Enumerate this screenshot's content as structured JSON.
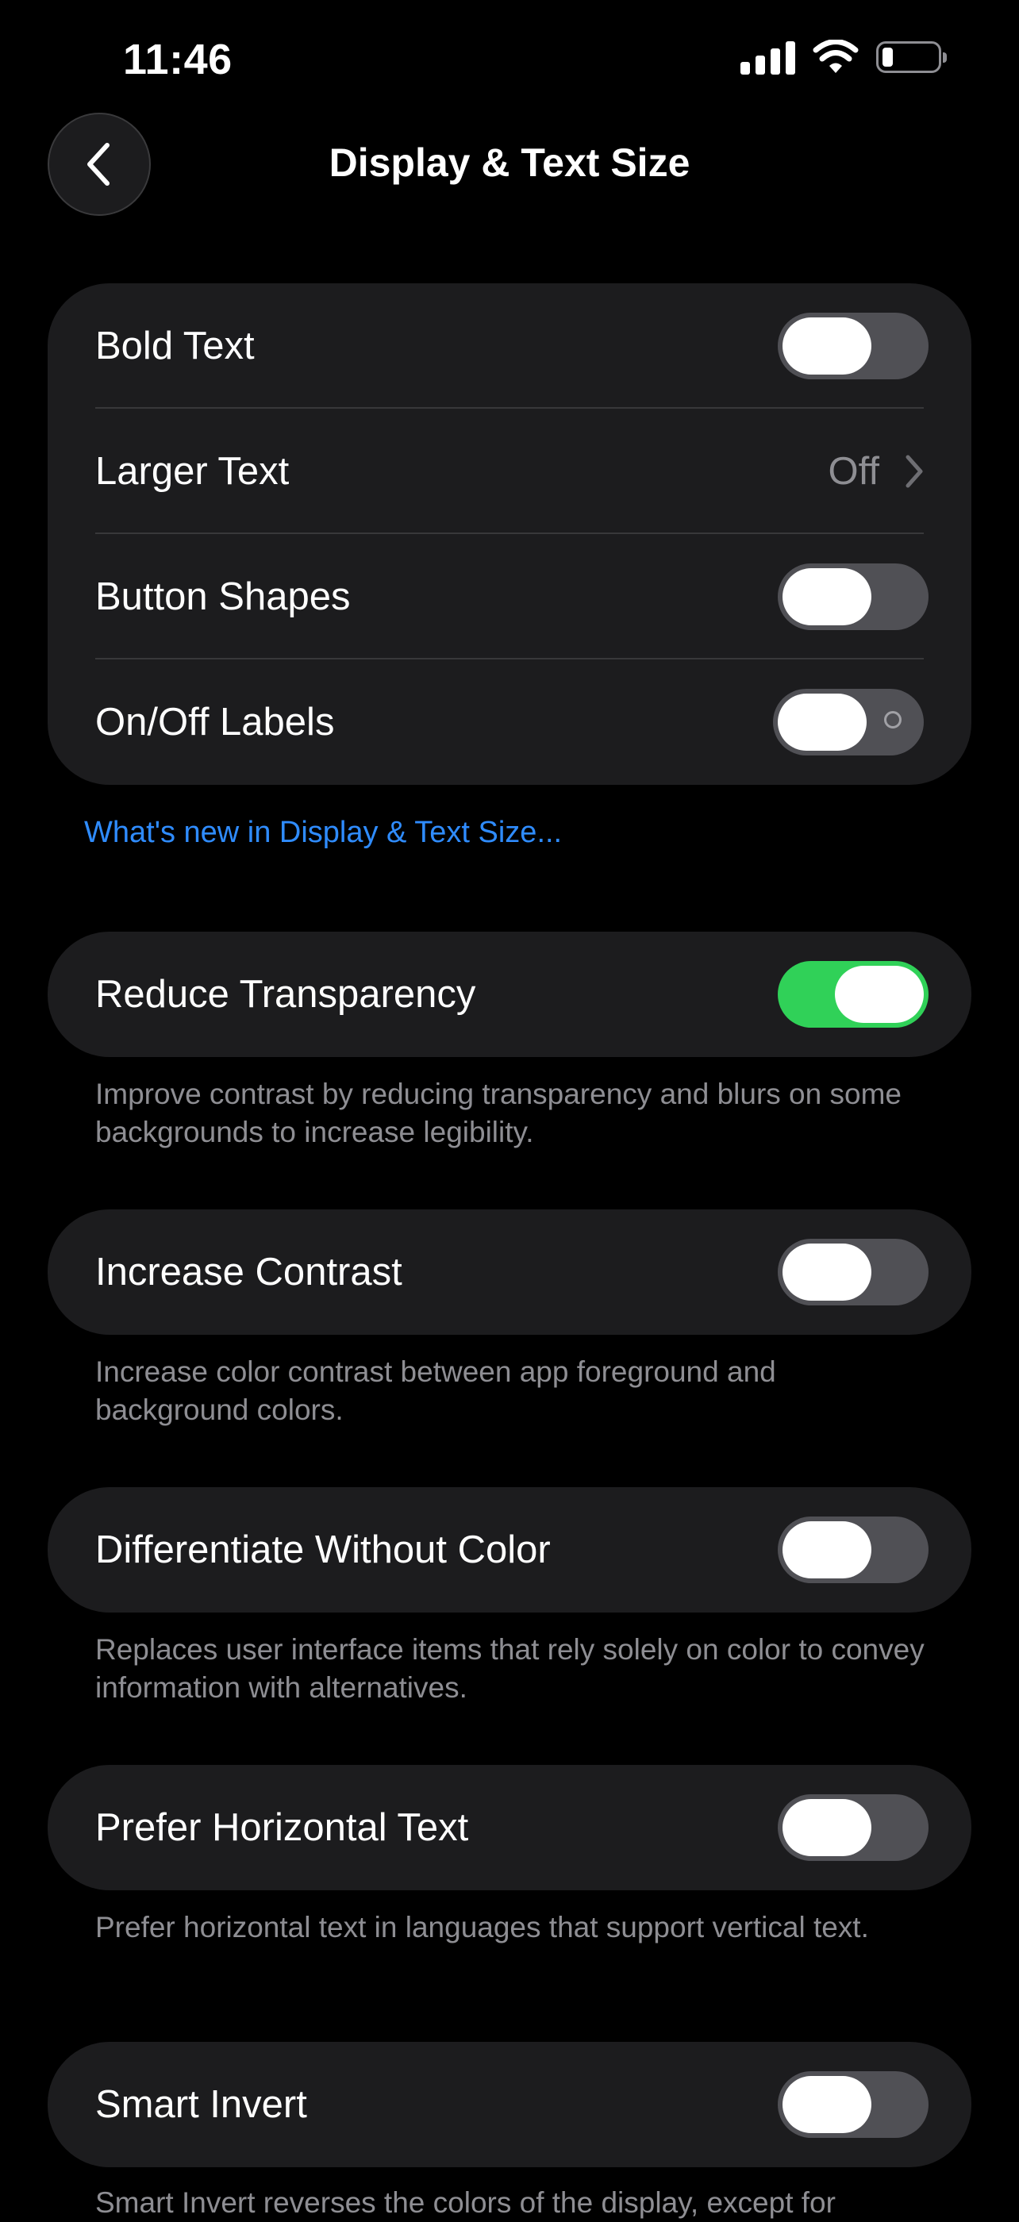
{
  "status": {
    "time": "11:46"
  },
  "header": {
    "title": "Display & Text Size"
  },
  "group1": {
    "rows": [
      {
        "label": "Bold Text"
      },
      {
        "label": "Larger Text",
        "value": "Off"
      },
      {
        "label": "Button Shapes"
      },
      {
        "label": "On/Off Labels"
      }
    ]
  },
  "link": "What's new in Display & Text Size...",
  "reduce_transparency": {
    "label": "Reduce Transparency",
    "footnote": "Improve contrast by reducing transparency and blurs on some backgrounds to increase legibility."
  },
  "increase_contrast": {
    "label": "Increase Contrast",
    "footnote": "Increase color contrast between app foreground and background colors."
  },
  "differentiate": {
    "label": "Differentiate Without Color",
    "footnote": "Replaces user interface items that rely solely on color to convey information with alternatives."
  },
  "horizontal": {
    "label": "Prefer Horizontal Text",
    "footnote": "Prefer horizontal text in languages that support vertical text."
  },
  "smart_invert": {
    "label": "Smart Invert",
    "footnote": "Smart Invert reverses the colors of the display, except for"
  },
  "colors": {
    "accent": "#2f8cff",
    "toggle_on": "#30d158",
    "card": "#1c1c1e"
  }
}
